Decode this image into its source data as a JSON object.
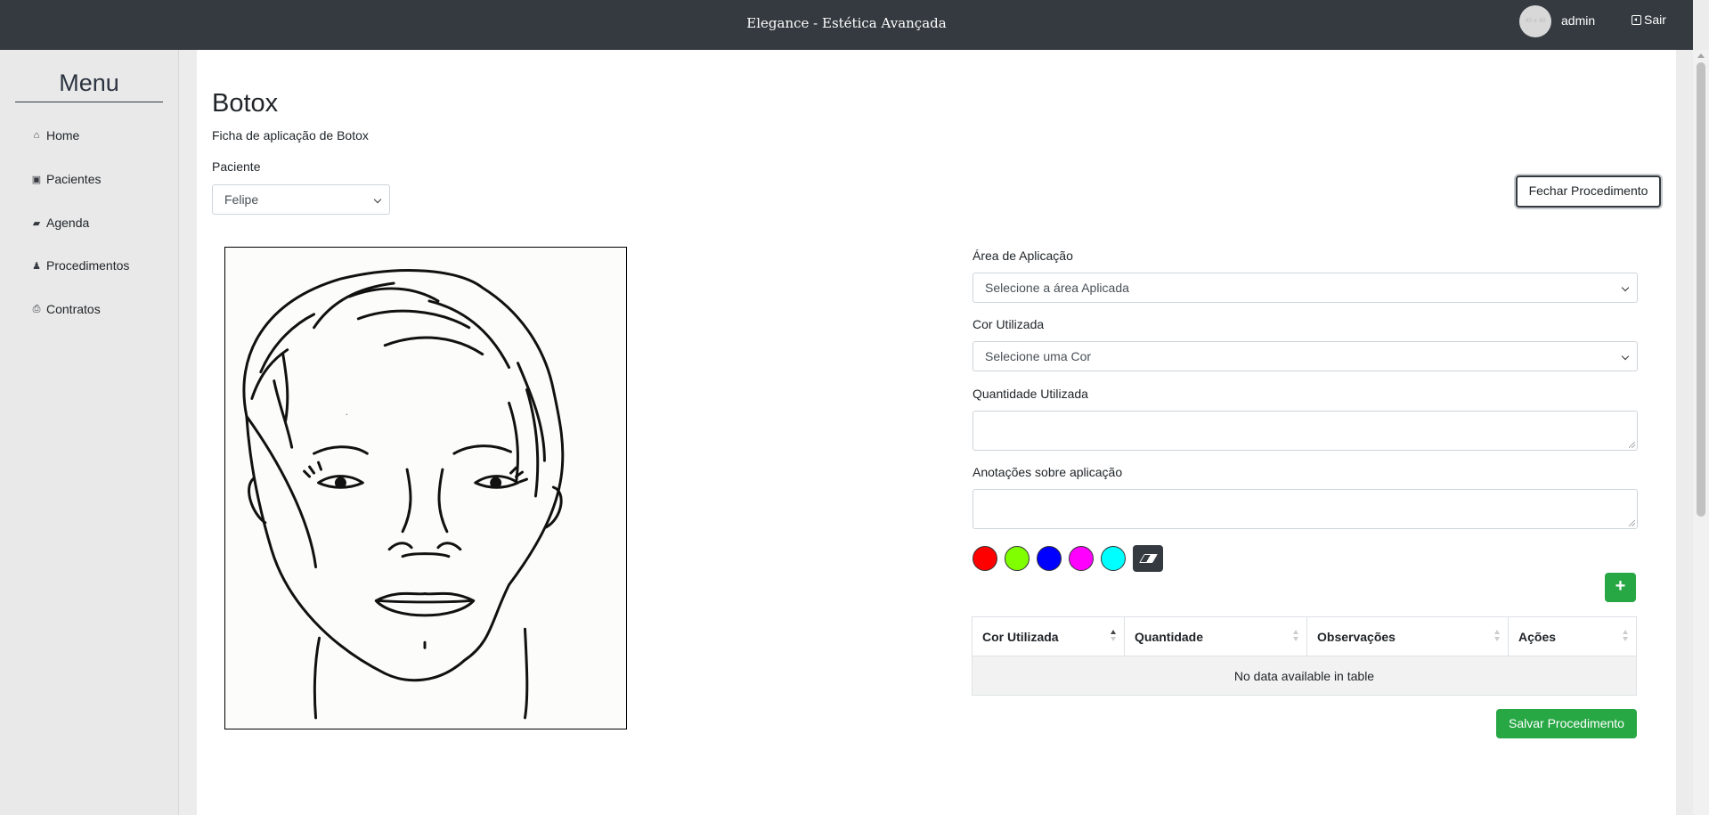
{
  "header": {
    "brand": "Elegance - Estética Avançada",
    "avatar_text": "40 x 40",
    "user": "admin",
    "logout": "Sair"
  },
  "sidebar": {
    "title": "Menu",
    "items": [
      {
        "label": "Home",
        "icon": "home-icon"
      },
      {
        "label": "Pacientes",
        "icon": "address-card-icon"
      },
      {
        "label": "Agenda",
        "icon": "book-icon"
      },
      {
        "label": "Procedimentos",
        "icon": "user-md-icon"
      },
      {
        "label": "Contratos",
        "icon": "print-icon"
      }
    ]
  },
  "page": {
    "title": "Botox",
    "subtitle": "Ficha de aplicação de Botox"
  },
  "patient": {
    "label": "Paciente",
    "value": "Felipe"
  },
  "close_button": "Fechar Procedimento",
  "form": {
    "area": {
      "label": "Área de Aplicação",
      "value": "Selecione a área Aplicada"
    },
    "color": {
      "label": "Cor Utilizada",
      "value": "Selecione uma Cor"
    },
    "quantity": {
      "label": "Quantidade Utilizada",
      "value": ""
    },
    "notes": {
      "label": "Anotações sobre aplicação",
      "value": ""
    }
  },
  "palette": [
    "#ff0000",
    "#7fff00",
    "#0000ff",
    "#ff00ff",
    "#00ffff"
  ],
  "table": {
    "columns": [
      "Cor Utilizada",
      "Quantidade",
      "Observações",
      "Ações"
    ],
    "empty": "No data available in table"
  },
  "add_button": "+",
  "save_button": "Salvar Procedimento"
}
